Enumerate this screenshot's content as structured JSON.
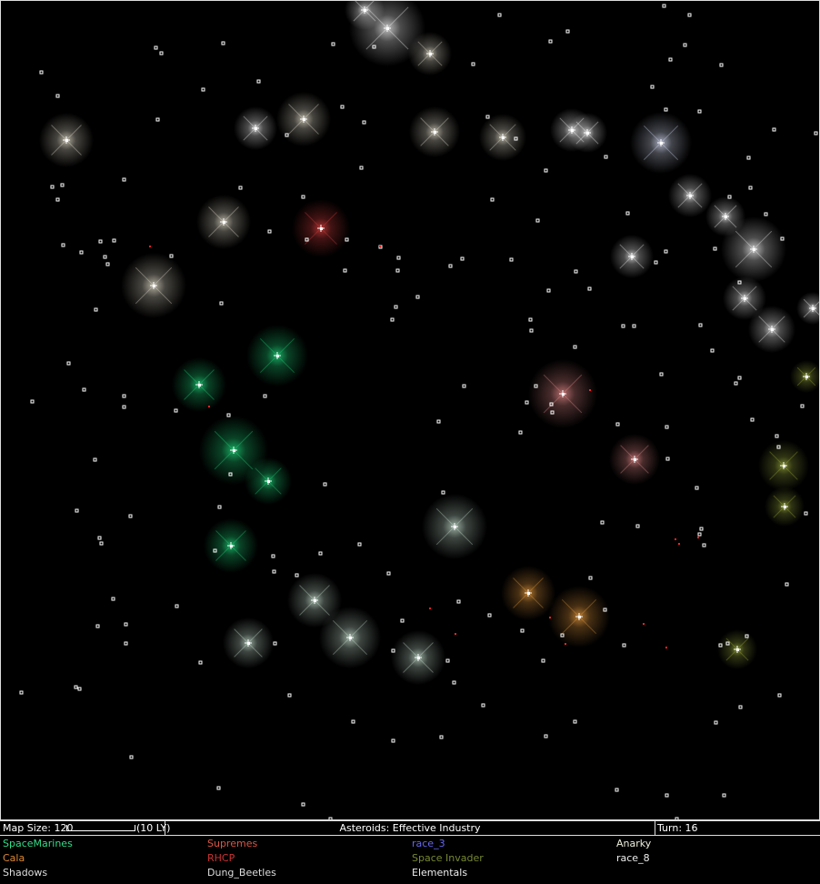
{
  "status_bar": {
    "map_size": "Map Size: 120",
    "scale_label": "(10 LY)",
    "tech": "Asteroids: Effective Industry",
    "turn": "Turn: 16"
  },
  "races": [
    {
      "name": "SpaceMarines",
      "color": "#33dd88"
    },
    {
      "name": "Supremes",
      "color": "#dd5544"
    },
    {
      "name": "race_3",
      "color": "#6666ee"
    },
    {
      "name": "Anarky",
      "color": "#eeeedd"
    },
    {
      "name": "Cala",
      "color": "#dd8833"
    },
    {
      "name": "RHCP",
      "color": "#cc3333"
    },
    {
      "name": "Space Invader",
      "color": "#778833"
    },
    {
      "name": "race_8",
      "color": "#eeeeee"
    },
    {
      "name": "Shadows",
      "color": "#dddddd"
    },
    {
      "name": "Dung_Beetles",
      "color": "#dddddd"
    },
    {
      "name": "Elementals",
      "color": "#eeeeee"
    }
  ],
  "colors": {
    "background": "#000000",
    "star_dot": "#ffffff",
    "fleet": "#ff2222"
  }
}
